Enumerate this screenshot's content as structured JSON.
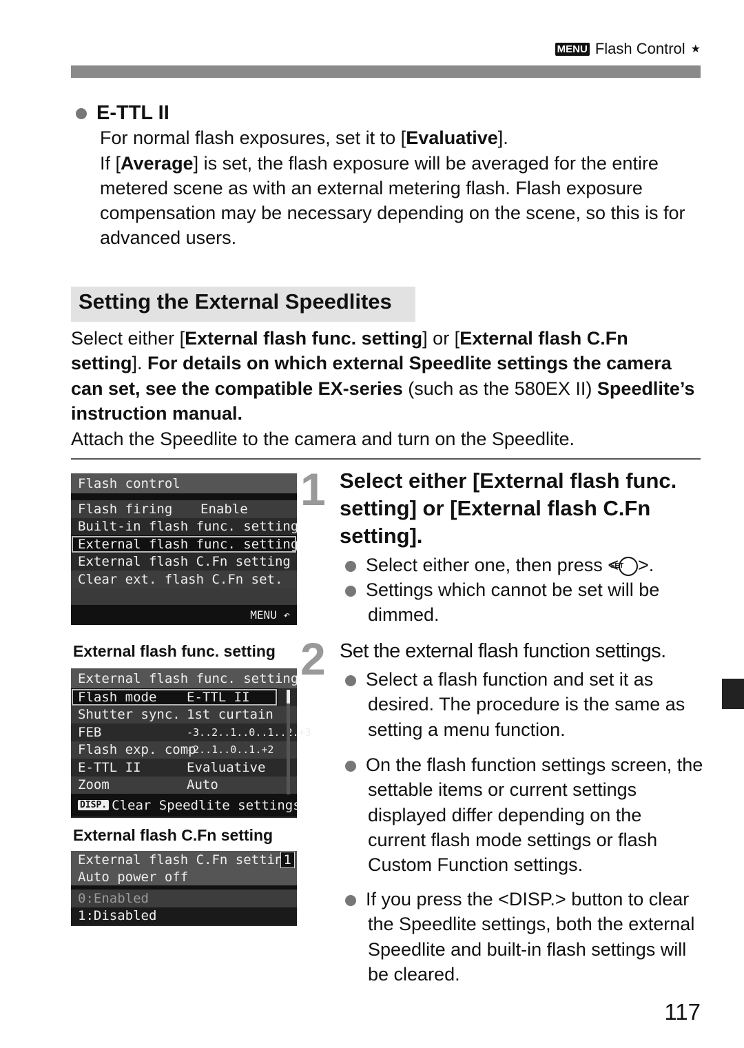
{
  "header": {
    "menu_icon": "MENU",
    "title": "Flash Control",
    "star": "★"
  },
  "ettl": {
    "heading": "E-TTL II",
    "line1_pre": "For normal flash exposures, set it to [",
    "line1_bold": "Evaluative",
    "line1_post": "].",
    "line2_pre": "If [",
    "line2_bold": "Average",
    "line2_post": "] is set, the flash exposure will be averaged for the entire metered scene as with an external metering flash. Flash exposure compensation may be necessary depending on the scene, so this is for advanced users."
  },
  "section": {
    "title": "Setting the External Speedlites",
    "p1": [
      "Select either [",
      "External flash func. setting",
      "] or [",
      "External flash C.Fn setting",
      "]. ",
      "For details on which external Speedlite settings the camera can set, see the compatible EX-series",
      " (such as the 580EX II) ",
      "Speedlite’s instruction manual."
    ],
    "p2": "Attach the Speedlite to the camera and turn on the Speedlite."
  },
  "screen1": {
    "title": "Flash control",
    "rows": [
      {
        "label": "Flash firing",
        "value": "Enable"
      },
      {
        "label": "Built-in flash func. setting",
        "value": ""
      },
      {
        "label": "External flash func. setting",
        "value": ""
      },
      {
        "label": "External flash C.Fn setting",
        "value": ""
      },
      {
        "label": "Clear ext. flash C.Fn set.",
        "value": ""
      }
    ],
    "footer": "MENU ↶"
  },
  "label2": "External flash func. setting",
  "screen2": {
    "title": "External flash func. setting",
    "rows": [
      {
        "label": "Flash mode",
        "value": "E-TTL II"
      },
      {
        "label": "Shutter sync.",
        "value": "1st curtain"
      },
      {
        "label": "FEB",
        "value": "-3..2..1..0..1..2.+3"
      },
      {
        "label": "Flash exp. comp",
        "value": "-2..1..0..1.+2"
      },
      {
        "label": "E-TTL II",
        "value": "Evaluative"
      },
      {
        "label": "Zoom",
        "value": "Auto"
      }
    ],
    "disp": "DISP.",
    "footer": "Clear Speedlite settings"
  },
  "label3": "External flash C.Fn setting",
  "screen3": {
    "title": "External flash C.Fn setting",
    "num": "1",
    "sub": "Auto power off",
    "rows": [
      "0:Enabled",
      "1:Disabled"
    ]
  },
  "step1": {
    "num": "1",
    "title": "Select either [External flash func. setting] or [External flash C.Fn setting].",
    "b1_pre": "Select either one, then press <",
    "b1_icon": "SET",
    "b1_post": ">.",
    "b2": "Settings which cannot be set will be dimmed."
  },
  "step2": {
    "num": "2",
    "title": "Set the external flash function settings.",
    "b1": "Select a flash function and set it as desired. The procedure is the same as setting a menu function.",
    "b2": "On the flash function settings screen, the settable items or current settings displayed differ depending on the current flash mode settings or flash Custom Function settings.",
    "b3_pre": "If you press the <",
    "b3_icon": "DISP.",
    "b3_post": "> button to clear the Speedlite settings, both the external Speedlite and built-in flash settings will be cleared."
  },
  "page_number": "117"
}
